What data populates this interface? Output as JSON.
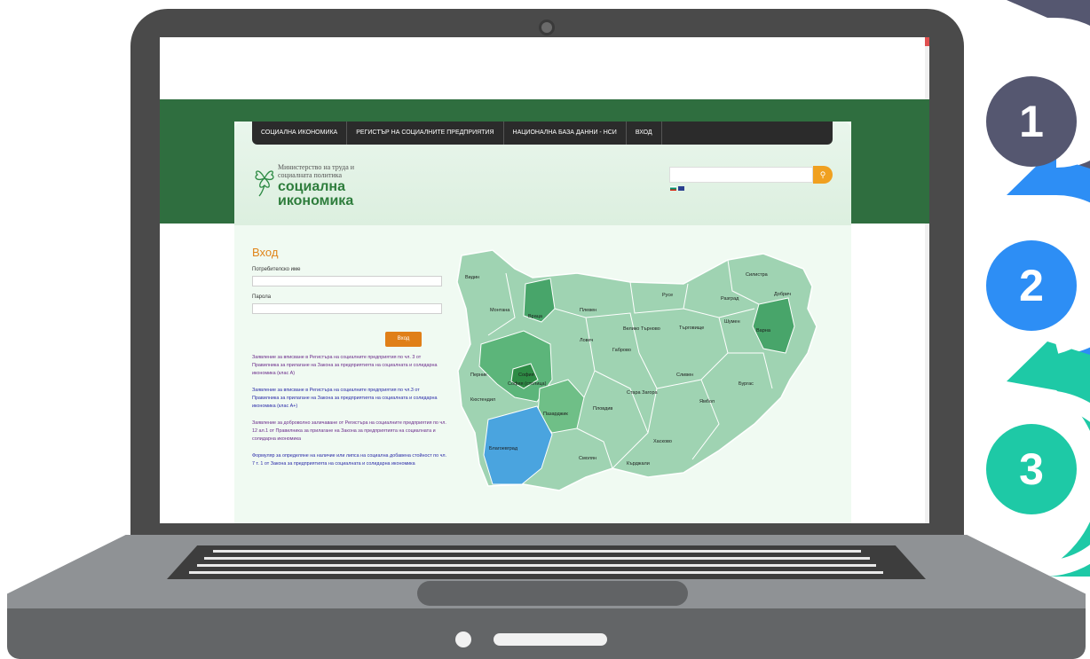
{
  "steps": [
    {
      "number": "1",
      "color": "#555770"
    },
    {
      "number": "2",
      "color": "#2d8ef5"
    },
    {
      "number": "3",
      "color": "#1ec9a6"
    }
  ],
  "site": {
    "nav": [
      "СОЦИАЛНА ИКОНОМИКА",
      "РЕГИСТЪР НА СОЦИАЛНИТЕ ПРЕДПРИЯТИЯ",
      "НАЦИОНАЛНА БАЗА ДАННИ - НСИ",
      "ВХОД"
    ],
    "logo": {
      "ministry": "Министерство на труда и социалната политика",
      "name_line1": "социална",
      "name_line2": "икономика"
    },
    "search": {
      "placeholder": ""
    },
    "login": {
      "title": "Вход",
      "username_label": "Потребителско име",
      "password_label": "Парола",
      "submit_label": "Вход"
    },
    "links": [
      "Заявление за вписване в Регистъра на социалните предприятия по чл. 3 от Правилника за прилагане на Закона за предприятията на социалната и солидарна икономика (клас А)",
      "Заявление за вписване в Регистъра на социалните предприятия по чл.3 от Правилника за прилагане на Закона за предприятията на социалната и солидарна икономика (клас А+)",
      "Заявление за доброволно заличаване от Регистъра на социалните предприятия по чл. 12 ал.1 от Правилника за прилагане на Закона за предприятията на социалната и солидарна икономика",
      "Формуляр за определяне на наличие или липса на социална добавена стойност по чл. 7 т. 1 от Закона за предприятията на социалната и солидарна икономика"
    ],
    "map_regions": [
      "Видин",
      "Монтана",
      "Враца",
      "Плевен",
      "Русе",
      "Силистра",
      "Разград",
      "Добрич",
      "Шумен",
      "Варна",
      "Търговище",
      "Велико Търново",
      "Ловеч",
      "Габрово",
      "Перник",
      "София",
      "София (столица)",
      "Кюстендил",
      "Пазарджик",
      "Пловдив",
      "Стара Загора",
      "Сливен",
      "Ямбол",
      "Бургас",
      "Благоевград",
      "Смолян",
      "Кърджали",
      "Хасково"
    ]
  }
}
